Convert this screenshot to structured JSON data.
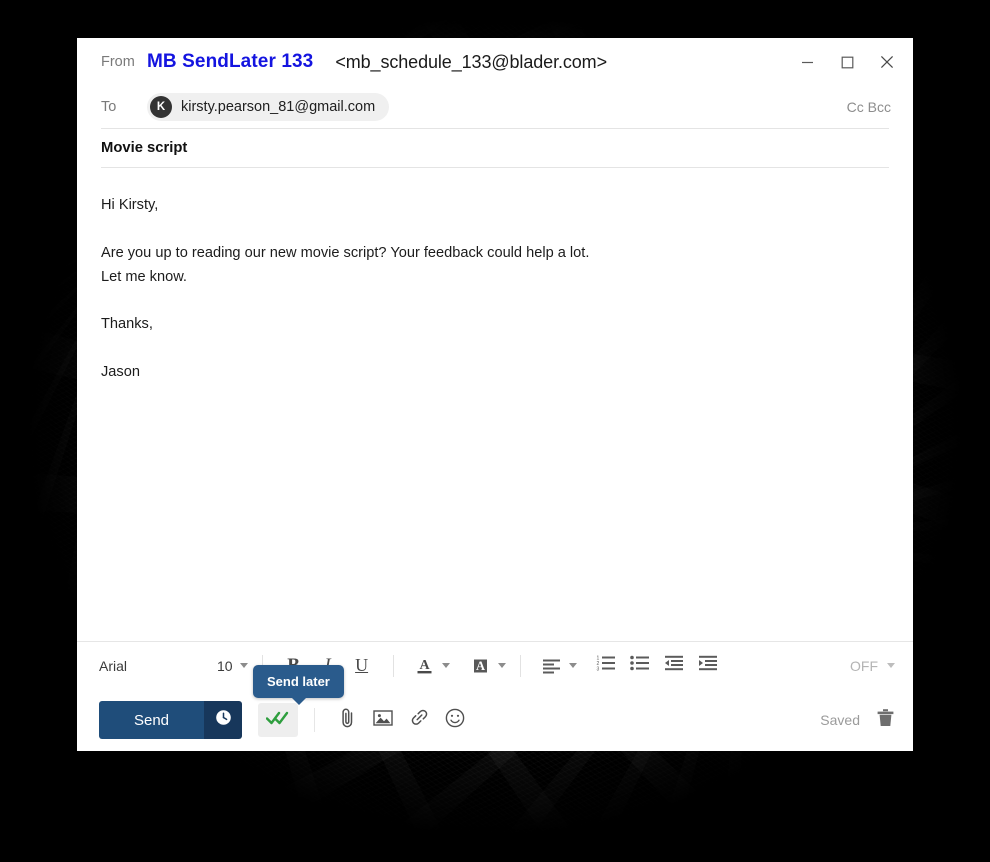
{
  "window": {
    "controls": {
      "minimize": "minimize-icon",
      "maximize": "maximize-icon",
      "close": "close-icon"
    }
  },
  "header": {
    "from_label": "From",
    "from_name": "MB SendLater 133",
    "from_address": "<mb_schedule_133@blader.com>",
    "to_label": "To",
    "recipient_initial": "K",
    "recipient_email": "kirsty.pearson_81@gmail.com",
    "cc_bcc_label": "Cc Bcc",
    "subject": "Movie script"
  },
  "body": {
    "lines": [
      "Hi Kirsty,",
      "",
      "Are you up to reading our new movie script? Your feedback could help a lot.",
      "Let me know.",
      "",
      "Thanks,",
      "",
      "Jason"
    ],
    "line0": "Hi Kirsty,",
    "line1": "Are you up to reading our new movie script? Your feedback could help a lot.",
    "line2": "Let me know.",
    "line3": "Thanks,",
    "line4": "Jason"
  },
  "toolbar": {
    "font_family": "Arial",
    "font_size": "10",
    "bold_label": "B",
    "italic_label": "I",
    "underline_label": "U",
    "text_color_label": "A",
    "highlight_color_label": "A",
    "tracking_state": "OFF",
    "icons": [
      "text-color-icon",
      "highlight-color-icon",
      "align-left-icon",
      "numbered-list-icon",
      "bulleted-list-icon",
      "decrease-indent-icon",
      "increase-indent-icon"
    ]
  },
  "tooltip": {
    "text": "Send later"
  },
  "actionbar": {
    "send_label": "Send",
    "send_later_icon": "clock-icon",
    "read_receipt_icon": "double-check-icon",
    "attach_icon": "paperclip-icon",
    "image_icon": "image-icon",
    "link_icon": "link-icon",
    "emoji_icon": "smiley-icon",
    "saved_label": "Saved",
    "delete_icon": "trash-icon"
  },
  "colors": {
    "brand_blue": "#1f4d7a",
    "brand_blue_dark": "#17375b",
    "from_name_blue": "#1414e0",
    "tooltip_blue": "#2a5b8c",
    "check_green": "#2e9e3e",
    "backdrop": "#000000",
    "window_bg": "#ffffff"
  }
}
